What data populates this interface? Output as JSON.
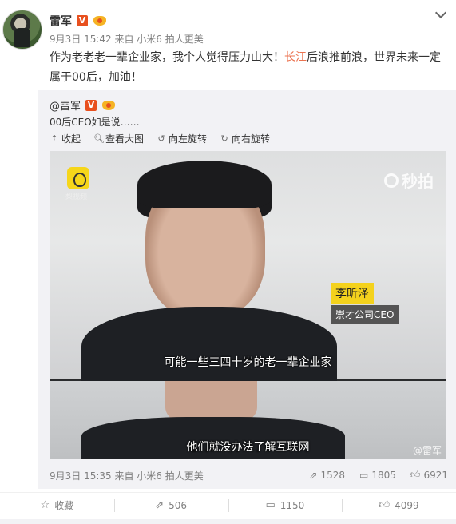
{
  "post": {
    "author": "雷军",
    "verified_badge": "V",
    "meta": "9月3日 15:42 来自 小米6 拍人更美",
    "text_part1": "作为老老老一辈企业家，我个人觉得压力山大！",
    "text_highlight": "长江",
    "text_part2": "后浪推前浪，世界未来一定属于00后，加油！"
  },
  "repost": {
    "author": "@雷军",
    "verified_badge": "V",
    "text": "00后CEO如是说……",
    "tools": [
      {
        "icon": "collapse-icon",
        "label": "收起"
      },
      {
        "icon": "magnify-icon",
        "label": "查看大图"
      },
      {
        "icon": "rotate-left-icon",
        "label": "向左旋转"
      },
      {
        "icon": "rotate-right-icon",
        "label": "向右旋转"
      }
    ],
    "video": {
      "watermark_app": "梨视频",
      "watermark_brand": "秒拍",
      "name_tag": "李昕泽",
      "title_tag": "崇才公司CEO",
      "subtitle_1": "可能一些三四十岁的老一辈企业家",
      "subtitle_2": "他们就没办法了解互联网",
      "weibo_mark": "@雷军"
    },
    "footer_meta": "9月3日 15:35 来自 小米6 拍人更美",
    "stats": {
      "reposts": "1528",
      "comments": "1805",
      "likes": "6921"
    }
  },
  "actions": {
    "favorite": "收藏",
    "repost": "506",
    "comment": "1150",
    "like": "4099"
  },
  "colors": {
    "highlight": "#eb7350",
    "verified": "#e8501f",
    "tag_yellow": "#f4d21d"
  }
}
